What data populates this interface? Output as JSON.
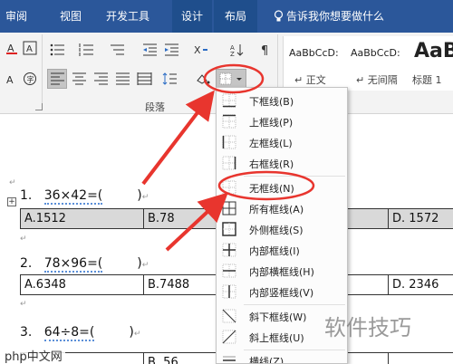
{
  "tabs": [
    {
      "label": "审阅",
      "active": false
    },
    {
      "label": "视图",
      "active": false
    },
    {
      "label": "开发工具",
      "active": false
    },
    {
      "label": "设计",
      "active": true
    },
    {
      "label": "布局",
      "active": true
    }
  ],
  "tell_me": "告诉我你想要做什么",
  "ribbon": {
    "paragraph_group_label": "段落",
    "styles": [
      {
        "sample": "AaBbCcD:",
        "name": "正文",
        "marker": "↵"
      },
      {
        "sample": "AaBbCcD:",
        "name": "无间隔",
        "marker": "↵"
      },
      {
        "sample": "AaB",
        "name": "标题 1",
        "marker": ""
      }
    ]
  },
  "document": {
    "questions": [
      {
        "num": "1.",
        "expr": "36×42=(",
        "close": ")"
      },
      {
        "num": "2.",
        "expr": "78×96=(",
        "close": ")"
      },
      {
        "num": "3.",
        "expr": "64÷8=(",
        "close": ")"
      }
    ],
    "rows": [
      {
        "a": "A.1512",
        "b": "B.78",
        "d": "D. 1572"
      },
      {
        "a": "A.6348",
        "b": "B.7488",
        "d": "D. 2346"
      },
      {
        "a": "",
        "b": "B. 56",
        "d": ""
      }
    ]
  },
  "menu": {
    "items": [
      {
        "label": "下框线(B)",
        "icon": "border-bottom-icon"
      },
      {
        "label": "上框线(P)",
        "icon": "border-top-icon"
      },
      {
        "label": "左框线(L)",
        "icon": "border-left-icon"
      },
      {
        "label": "右框线(R)",
        "icon": "border-right-icon"
      },
      {
        "label": "无框线(N)",
        "icon": "border-none-icon"
      },
      {
        "label": "所有框线(A)",
        "icon": "border-all-icon"
      },
      {
        "label": "外侧框线(S)",
        "icon": "border-outside-icon"
      },
      {
        "label": "内部框线(I)",
        "icon": "border-inside-icon"
      },
      {
        "label": "内部横框线(H)",
        "icon": "border-inside-horizontal-icon"
      },
      {
        "label": "内部竖框线(V)",
        "icon": "border-inside-vertical-icon"
      },
      {
        "label": "斜下框线(W)",
        "icon": "diagonal-down-border-icon"
      },
      {
        "label": "斜上框线(U)",
        "icon": "diagonal-up-border-icon"
      },
      {
        "label": "横线(Z)",
        "icon": "horizontal-line-icon"
      }
    ]
  },
  "watermark": "软件技巧",
  "site_label": "php中文网",
  "colors": {
    "tabbar": "#2b579a",
    "annotation_red": "#e8352e",
    "menu_bg": "#fcfcfc",
    "table_shade": "#d9d9d9"
  }
}
